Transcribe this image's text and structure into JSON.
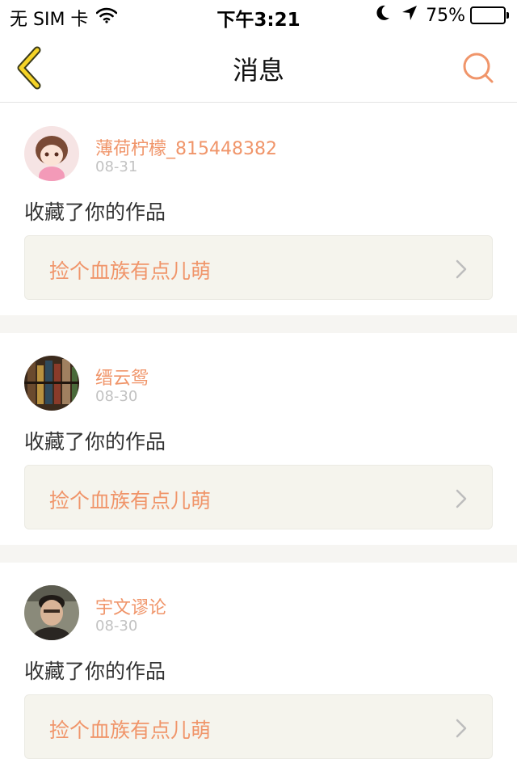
{
  "status_bar": {
    "carrier": "无 SIM 卡",
    "time": "下午3:21",
    "battery": "75%",
    "battery_level": 0.75,
    "icons": [
      "wifi-icon",
      "moon-icon",
      "location-arrow-icon",
      "battery-icon"
    ]
  },
  "nav": {
    "title": "消息",
    "back_icon": "chevron-left-icon",
    "search_icon": "search-icon"
  },
  "colors": {
    "accent": "#f0956a",
    "back_icon": "#f5d327",
    "date": "#c2c2c2",
    "card_bg": "#f5f4ed",
    "separator": "#f6f5f2"
  },
  "messages": [
    {
      "username": "薄荷柠檬_815448382",
      "date": "08-31",
      "action": "收藏了你的作品",
      "work_title": "捡个血族有点儿萌"
    },
    {
      "username": "缙云鸳",
      "date": "08-30",
      "action": "收藏了你的作品",
      "work_title": "捡个血族有点儿萌"
    },
    {
      "username": "宇文谬论",
      "date": "08-30",
      "action": "收藏了你的作品",
      "work_title": "捡个血族有点儿萌"
    }
  ]
}
